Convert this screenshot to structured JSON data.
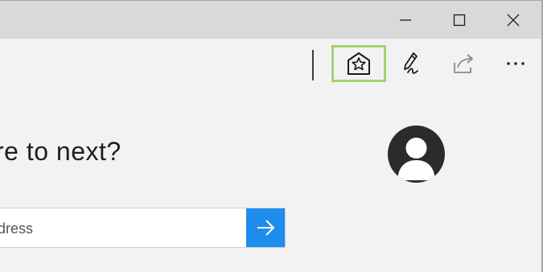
{
  "window_controls": {
    "minimize": "minimize-icon",
    "maximize": "maximize-icon",
    "close": "close-icon"
  },
  "toolbar": {
    "buttons": [
      {
        "name": "hub-favorites-icon",
        "highlighted": true
      },
      {
        "name": "web-note-pen-icon",
        "highlighted": false
      },
      {
        "name": "share-icon",
        "highlighted": false
      },
      {
        "name": "more-icon",
        "highlighted": false
      }
    ],
    "highlight_color": "#a2d36f"
  },
  "main": {
    "headline": "re to next?",
    "avatar_icon": "user-avatar-icon",
    "search": {
      "placeholder": "dress"
    },
    "go_button_icon": "arrow-right-icon",
    "accent_color": "#1e8ded"
  }
}
